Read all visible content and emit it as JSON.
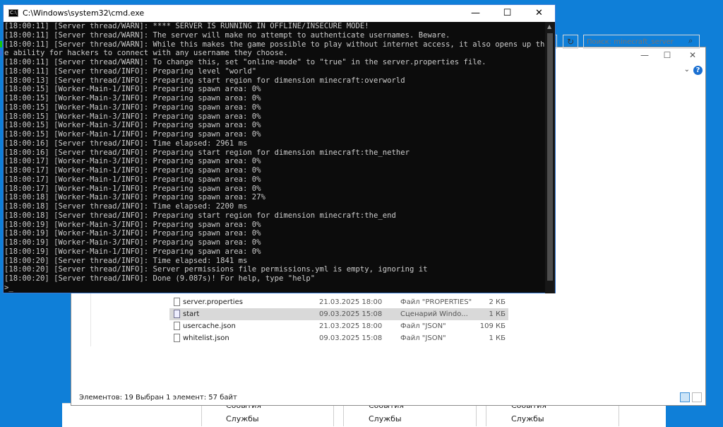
{
  "cmd": {
    "title": "C:\\Windows\\system32\\cmd.exe",
    "icon_name": "console-icon",
    "minimize_glyph": "—",
    "maximize_glyph": "☐",
    "close_glyph": "✕",
    "lines": [
      "[18:00:11] [Server thread/WARN]: **** SERVER IS RUNNING IN OFFLINE/INSECURE MODE!",
      "[18:00:11] [Server thread/WARN]: The server will make no attempt to authenticate usernames. Beware.",
      "[18:00:11] [Server thread/WARN]: While this makes the game possible to play without internet access, it also opens up th",
      "e ability for hackers to connect with any username they choose.",
      "[18:00:11] [Server thread/WARN]: To change this, set \"online-mode\" to \"true\" in the server.properties file.",
      "[18:00:11] [Server thread/INFO]: Preparing level \"world\"",
      "[18:00:13] [Server thread/INFO]: Preparing start region for dimension minecraft:overworld",
      "[18:00:15] [Worker-Main-1/INFO]: Preparing spawn area: 0%",
      "[18:00:15] [Worker-Main-3/INFO]: Preparing spawn area: 0%",
      "[18:00:15] [Worker-Main-3/INFO]: Preparing spawn area: 0%",
      "[18:00:15] [Worker-Main-3/INFO]: Preparing spawn area: 0%",
      "[18:00:15] [Worker-Main-3/INFO]: Preparing spawn area: 0%",
      "[18:00:15] [Worker-Main-1/INFO]: Preparing spawn area: 0%",
      "[18:00:16] [Server thread/INFO]: Time elapsed: 2961 ms",
      "[18:00:16] [Server thread/INFO]: Preparing start region for dimension minecraft:the_nether",
      "[18:00:17] [Worker-Main-3/INFO]: Preparing spawn area: 0%",
      "[18:00:17] [Worker-Main-1/INFO]: Preparing spawn area: 0%",
      "[18:00:17] [Worker-Main-1/INFO]: Preparing spawn area: 0%",
      "[18:00:17] [Worker-Main-1/INFO]: Preparing spawn area: 0%",
      "[18:00:18] [Worker-Main-3/INFO]: Preparing spawn area: 27%",
      "[18:00:18] [Server thread/INFO]: Time elapsed: 2200 ms",
      "[18:00:18] [Server thread/INFO]: Preparing start region for dimension minecraft:the_end",
      "[18:00:19] [Worker-Main-3/INFO]: Preparing spawn area: 0%",
      "[18:00:19] [Worker-Main-3/INFO]: Preparing spawn area: 0%",
      "[18:00:19] [Worker-Main-3/INFO]: Preparing spawn area: 0%",
      "[18:00:19] [Worker-Main-1/INFO]: Preparing spawn area: 0%",
      "[18:00:20] [Server thread/INFO]: Time elapsed: 1841 ms",
      "[18:00:20] [Server thread/INFO]: Server permissions file permissions.yml is empty, ignoring it",
      "[18:00:20] [Server thread/INFO]: Done (9.087s)! For help, type \"help\"",
      ">_"
    ]
  },
  "explorer": {
    "search_placeholder": "Поиск: minecraft_server",
    "refresh_glyph": "↻",
    "help_glyph": "?",
    "chevron_glyph": "⌄",
    "minimize_glyph": "—",
    "maximize_glyph": "☐",
    "close_glyph": "✕",
    "files": [
      {
        "name": "server.properties",
        "date": "21.03.2025 18:00",
        "type": "Файл \"PROPERTIES\"",
        "size": "2 КБ",
        "icon": "file-icon",
        "selected": false
      },
      {
        "name": "start",
        "date": "09.03.2025 15:08",
        "type": "Сценарий Windo...",
        "size": "1 КБ",
        "icon": "script-file-icon",
        "selected": true
      },
      {
        "name": "usercache.json",
        "date": "21.03.2025 18:00",
        "type": "Файл \"JSON\"",
        "size": "109 КБ",
        "icon": "file-icon",
        "selected": false
      },
      {
        "name": "whitelist.json",
        "date": "09.03.2025 15:08",
        "type": "Файл \"JSON\"",
        "size": "1 КБ",
        "icon": "file-icon",
        "selected": false
      }
    ],
    "status": {
      "items_count": "Элементов: 19",
      "selected_info": "Выбран 1 элемент: 57 байт"
    }
  },
  "background": {
    "labels_top": [
      "События",
      "События",
      "События"
    ],
    "labels_bottom": [
      "Службы",
      "Службы",
      "Службы"
    ]
  },
  "colors": {
    "desktop": "#0f7fd8",
    "console_bg": "#0c0c0c",
    "console_text": "#cccccc",
    "selection": "#d9d9d9"
  }
}
